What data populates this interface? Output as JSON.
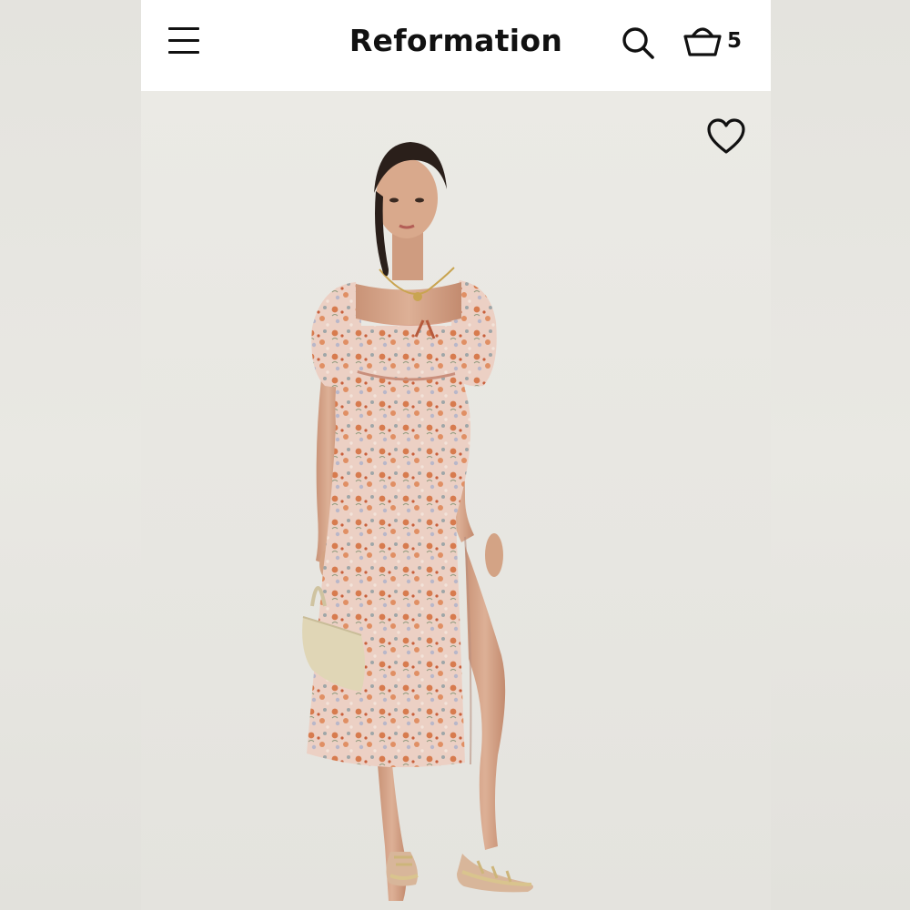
{
  "header": {
    "menu_icon": "hamburger-menu-icon",
    "brand_name": "Reformation",
    "search_icon": "search-icon",
    "cart_icon": "basket-icon",
    "cart_count": "5"
  },
  "product": {
    "favorite_icon": "heart-outline-icon",
    "image_description_icon": "product-photo"
  },
  "colors": {
    "header_bg": "#ffffff",
    "photo_bg": "#ebeae5",
    "dress_pink": "#e9c7bb",
    "print_orange": "#d9774a",
    "text": "#111111"
  }
}
